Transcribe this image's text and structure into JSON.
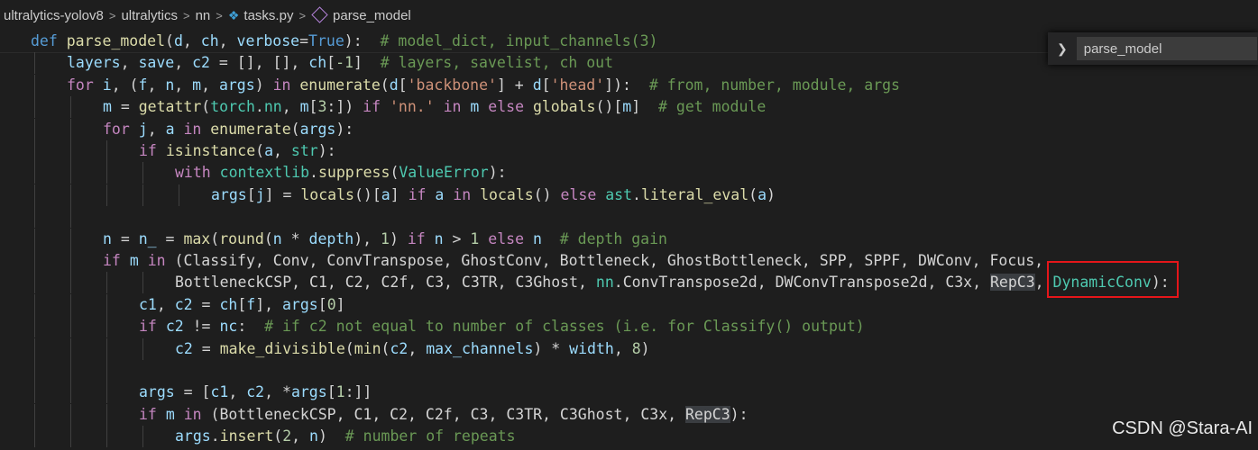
{
  "breadcrumb": {
    "items": [
      "ultralytics-yolov8",
      "ultralytics",
      "nn",
      "tasks.py",
      "parse_model"
    ],
    "separator": ">"
  },
  "find_widget": {
    "value": "parse_model"
  },
  "code_lines": [
    {
      "indent": 0,
      "tokens": [
        {
          "t": "def ",
          "c": "kw"
        },
        {
          "t": "parse_model",
          "c": "fn"
        },
        {
          "t": "(",
          "c": ""
        },
        {
          "t": "d",
          "c": "vr"
        },
        {
          "t": ", ",
          "c": ""
        },
        {
          "t": "ch",
          "c": "vr"
        },
        {
          "t": ", ",
          "c": ""
        },
        {
          "t": "verbose",
          "c": "vr"
        },
        {
          "t": "=",
          "c": ""
        },
        {
          "t": "True",
          "c": "kw"
        },
        {
          "t": "):  ",
          "c": ""
        },
        {
          "t": "# model_dict, input_channels(3)",
          "c": "cm"
        }
      ]
    },
    {
      "indent": 1,
      "tokens": [
        {
          "t": "layers",
          "c": "vr"
        },
        {
          "t": ", ",
          "c": ""
        },
        {
          "t": "save",
          "c": "vr"
        },
        {
          "t": ", ",
          "c": ""
        },
        {
          "t": "c2",
          "c": "vr"
        },
        {
          "t": " = [], [], ",
          "c": ""
        },
        {
          "t": "ch",
          "c": "vr"
        },
        {
          "t": "[",
          "c": ""
        },
        {
          "t": "-1",
          "c": "nu"
        },
        {
          "t": "]  ",
          "c": ""
        },
        {
          "t": "# layers, savelist, ch out",
          "c": "cm"
        }
      ]
    },
    {
      "indent": 1,
      "tokens": [
        {
          "t": "for ",
          "c": "ck"
        },
        {
          "t": "i",
          "c": "vr"
        },
        {
          "t": ", (",
          "c": ""
        },
        {
          "t": "f",
          "c": "vr"
        },
        {
          "t": ", ",
          "c": ""
        },
        {
          "t": "n",
          "c": "vr"
        },
        {
          "t": ", ",
          "c": ""
        },
        {
          "t": "m",
          "c": "vr"
        },
        {
          "t": ", ",
          "c": ""
        },
        {
          "t": "args",
          "c": "vr"
        },
        {
          "t": ") ",
          "c": ""
        },
        {
          "t": "in ",
          "c": "ck"
        },
        {
          "t": "enumerate",
          "c": "fn"
        },
        {
          "t": "(",
          "c": ""
        },
        {
          "t": "d",
          "c": "vr"
        },
        {
          "t": "[",
          "c": ""
        },
        {
          "t": "'backbone'",
          "c": "st"
        },
        {
          "t": "] + ",
          "c": ""
        },
        {
          "t": "d",
          "c": "vr"
        },
        {
          "t": "[",
          "c": ""
        },
        {
          "t": "'head'",
          "c": "st"
        },
        {
          "t": "]):  ",
          "c": ""
        },
        {
          "t": "# from, number, module, args",
          "c": "cm"
        }
      ]
    },
    {
      "indent": 2,
      "tokens": [
        {
          "t": "m",
          "c": "vr"
        },
        {
          "t": " = ",
          "c": ""
        },
        {
          "t": "getattr",
          "c": "fn"
        },
        {
          "t": "(",
          "c": ""
        },
        {
          "t": "torch",
          "c": "cl"
        },
        {
          "t": ".",
          "c": ""
        },
        {
          "t": "nn",
          "c": "cl"
        },
        {
          "t": ", ",
          "c": ""
        },
        {
          "t": "m",
          "c": "vr"
        },
        {
          "t": "[",
          "c": ""
        },
        {
          "t": "3",
          "c": "nu"
        },
        {
          "t": ":]) ",
          "c": ""
        },
        {
          "t": "if ",
          "c": "ck"
        },
        {
          "t": "'nn.'",
          "c": "st"
        },
        {
          "t": " ",
          "c": ""
        },
        {
          "t": "in ",
          "c": "ck"
        },
        {
          "t": "m",
          "c": "vr"
        },
        {
          "t": " ",
          "c": ""
        },
        {
          "t": "else ",
          "c": "ck"
        },
        {
          "t": "globals",
          "c": "fn"
        },
        {
          "t": "()[",
          "c": ""
        },
        {
          "t": "m",
          "c": "vr"
        },
        {
          "t": "]  ",
          "c": ""
        },
        {
          "t": "# get module",
          "c": "cm"
        }
      ]
    },
    {
      "indent": 2,
      "tokens": [
        {
          "t": "for ",
          "c": "ck"
        },
        {
          "t": "j",
          "c": "vr"
        },
        {
          "t": ", ",
          "c": ""
        },
        {
          "t": "a",
          "c": "vr"
        },
        {
          "t": " ",
          "c": ""
        },
        {
          "t": "in ",
          "c": "ck"
        },
        {
          "t": "enumerate",
          "c": "fn"
        },
        {
          "t": "(",
          "c": ""
        },
        {
          "t": "args",
          "c": "vr"
        },
        {
          "t": "):",
          "c": ""
        }
      ]
    },
    {
      "indent": 3,
      "tokens": [
        {
          "t": "if ",
          "c": "ck"
        },
        {
          "t": "isinstance",
          "c": "fn"
        },
        {
          "t": "(",
          "c": ""
        },
        {
          "t": "a",
          "c": "vr"
        },
        {
          "t": ", ",
          "c": ""
        },
        {
          "t": "str",
          "c": "cl"
        },
        {
          "t": "):",
          "c": ""
        }
      ]
    },
    {
      "indent": 4,
      "tokens": [
        {
          "t": "with ",
          "c": "ck"
        },
        {
          "t": "contextlib",
          "c": "cl"
        },
        {
          "t": ".",
          "c": ""
        },
        {
          "t": "suppress",
          "c": "fn"
        },
        {
          "t": "(",
          "c": ""
        },
        {
          "t": "ValueError",
          "c": "cl"
        },
        {
          "t": "):",
          "c": ""
        }
      ]
    },
    {
      "indent": 5,
      "tokens": [
        {
          "t": "args",
          "c": "vr"
        },
        {
          "t": "[",
          "c": ""
        },
        {
          "t": "j",
          "c": "vr"
        },
        {
          "t": "] = ",
          "c": ""
        },
        {
          "t": "locals",
          "c": "fn"
        },
        {
          "t": "()[",
          "c": ""
        },
        {
          "t": "a",
          "c": "vr"
        },
        {
          "t": "] ",
          "c": ""
        },
        {
          "t": "if ",
          "c": "ck"
        },
        {
          "t": "a",
          "c": "vr"
        },
        {
          "t": " ",
          "c": ""
        },
        {
          "t": "in ",
          "c": "ck"
        },
        {
          "t": "locals",
          "c": "fn"
        },
        {
          "t": "() ",
          "c": ""
        },
        {
          "t": "else ",
          "c": "ck"
        },
        {
          "t": "ast",
          "c": "cl"
        },
        {
          "t": ".",
          "c": ""
        },
        {
          "t": "literal_eval",
          "c": "fn"
        },
        {
          "t": "(",
          "c": ""
        },
        {
          "t": "a",
          "c": "vr"
        },
        {
          "t": ")",
          "c": ""
        }
      ]
    },
    {
      "indent": 2,
      "tokens": []
    },
    {
      "indent": 2,
      "tokens": [
        {
          "t": "n",
          "c": "vr"
        },
        {
          "t": " = ",
          "c": ""
        },
        {
          "t": "n_",
          "c": "vr"
        },
        {
          "t": " = ",
          "c": ""
        },
        {
          "t": "max",
          "c": "fn"
        },
        {
          "t": "(",
          "c": ""
        },
        {
          "t": "round",
          "c": "fn"
        },
        {
          "t": "(",
          "c": ""
        },
        {
          "t": "n",
          "c": "vr"
        },
        {
          "t": " * ",
          "c": ""
        },
        {
          "t": "depth",
          "c": "vr"
        },
        {
          "t": "), ",
          "c": ""
        },
        {
          "t": "1",
          "c": "nu"
        },
        {
          "t": ") ",
          "c": ""
        },
        {
          "t": "if ",
          "c": "ck"
        },
        {
          "t": "n",
          "c": "vr"
        },
        {
          "t": " > ",
          "c": ""
        },
        {
          "t": "1",
          "c": "nu"
        },
        {
          "t": " ",
          "c": ""
        },
        {
          "t": "else ",
          "c": "ck"
        },
        {
          "t": "n",
          "c": "vr"
        },
        {
          "t": "  ",
          "c": ""
        },
        {
          "t": "# depth gain",
          "c": "cm"
        }
      ]
    },
    {
      "indent": 2,
      "tokens": [
        {
          "t": "if ",
          "c": "ck"
        },
        {
          "t": "m",
          "c": "vr"
        },
        {
          "t": " ",
          "c": ""
        },
        {
          "t": "in ",
          "c": "ck"
        },
        {
          "t": "(",
          "c": ""
        },
        {
          "t": "Classify, Conv, ConvTranspose, GhostConv, Bottleneck, GhostBottleneck, SPP, SPPF, DWConv, Focus,",
          "c": ""
        }
      ]
    },
    {
      "indent": 4,
      "tokens": [
        {
          "t": "BottleneckCSP, C1, C2, C2f, C3, C3TR, C3Ghost, ",
          "c": ""
        },
        {
          "t": "nn",
          "c": "cl"
        },
        {
          "t": ".ConvTranspose2d, DWConvTranspose2d, C3x, ",
          "c": ""
        },
        {
          "t": "RepC3",
          "c": "hl"
        },
        {
          "t": ", ",
          "c": ""
        },
        {
          "t": "DynamicConv",
          "c": "cl"
        },
        {
          "t": "):",
          "c": ""
        }
      ]
    },
    {
      "indent": 3,
      "tokens": [
        {
          "t": "c1",
          "c": "vr"
        },
        {
          "t": ", ",
          "c": ""
        },
        {
          "t": "c2",
          "c": "vr"
        },
        {
          "t": " = ",
          "c": ""
        },
        {
          "t": "ch",
          "c": "vr"
        },
        {
          "t": "[",
          "c": ""
        },
        {
          "t": "f",
          "c": "vr"
        },
        {
          "t": "], ",
          "c": ""
        },
        {
          "t": "args",
          "c": "vr"
        },
        {
          "t": "[",
          "c": ""
        },
        {
          "t": "0",
          "c": "nu"
        },
        {
          "t": "]",
          "c": ""
        }
      ]
    },
    {
      "indent": 3,
      "tokens": [
        {
          "t": "if ",
          "c": "ck"
        },
        {
          "t": "c2",
          "c": "vr"
        },
        {
          "t": " != ",
          "c": ""
        },
        {
          "t": "nc",
          "c": "vr"
        },
        {
          "t": ":  ",
          "c": ""
        },
        {
          "t": "# if c2 not equal to number of classes (i.e. for Classify() output)",
          "c": "cm"
        }
      ]
    },
    {
      "indent": 4,
      "tokens": [
        {
          "t": "c2",
          "c": "vr"
        },
        {
          "t": " = ",
          "c": ""
        },
        {
          "t": "make_divisible",
          "c": "fn"
        },
        {
          "t": "(",
          "c": ""
        },
        {
          "t": "min",
          "c": "fn"
        },
        {
          "t": "(",
          "c": ""
        },
        {
          "t": "c2",
          "c": "vr"
        },
        {
          "t": ", ",
          "c": ""
        },
        {
          "t": "max_channels",
          "c": "vr"
        },
        {
          "t": ") * ",
          "c": ""
        },
        {
          "t": "width",
          "c": "vr"
        },
        {
          "t": ", ",
          "c": ""
        },
        {
          "t": "8",
          "c": "nu"
        },
        {
          "t": ")",
          "c": ""
        }
      ]
    },
    {
      "indent": 3,
      "tokens": []
    },
    {
      "indent": 3,
      "tokens": [
        {
          "t": "args",
          "c": "vr"
        },
        {
          "t": " = [",
          "c": ""
        },
        {
          "t": "c1",
          "c": "vr"
        },
        {
          "t": ", ",
          "c": ""
        },
        {
          "t": "c2",
          "c": "vr"
        },
        {
          "t": ", *",
          "c": ""
        },
        {
          "t": "args",
          "c": "vr"
        },
        {
          "t": "[",
          "c": ""
        },
        {
          "t": "1",
          "c": "nu"
        },
        {
          "t": ":]]",
          "c": ""
        }
      ]
    },
    {
      "indent": 3,
      "tokens": [
        {
          "t": "if ",
          "c": "ck"
        },
        {
          "t": "m",
          "c": "vr"
        },
        {
          "t": " ",
          "c": ""
        },
        {
          "t": "in ",
          "c": "ck"
        },
        {
          "t": "(",
          "c": ""
        },
        {
          "t": "BottleneckCSP, C1, C2, C2f, C3, C3TR, C3Ghost, C3x, ",
          "c": ""
        },
        {
          "t": "RepC3",
          "c": "hl"
        },
        {
          "t": "):",
          "c": ""
        }
      ]
    },
    {
      "indent": 4,
      "tokens": [
        {
          "t": "args",
          "c": "vr"
        },
        {
          "t": ".",
          "c": ""
        },
        {
          "t": "insert",
          "c": "fn"
        },
        {
          "t": "(",
          "c": ""
        },
        {
          "t": "2",
          "c": "nu"
        },
        {
          "t": ", ",
          "c": ""
        },
        {
          "t": "n",
          "c": "vr"
        },
        {
          "t": ")  ",
          "c": ""
        },
        {
          "t": "# number of repeats",
          "c": "cm"
        }
      ]
    }
  ],
  "watermark": "CSDN @Stara-AI"
}
